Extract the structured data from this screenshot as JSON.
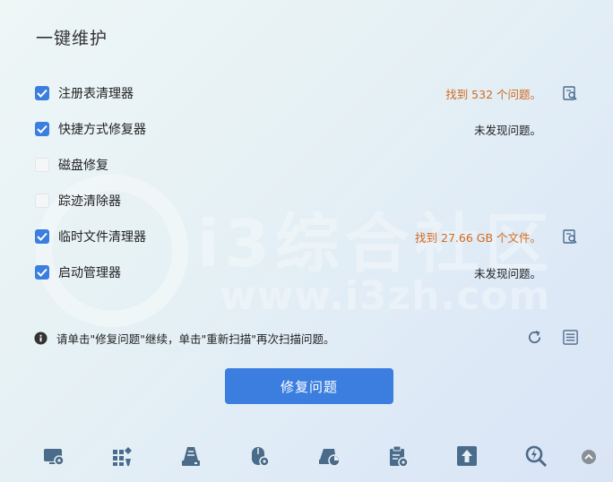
{
  "title": "一键维护",
  "items": [
    {
      "label": "注册表清理器",
      "checked": true,
      "status": "找到 532 个问题。",
      "status_type": "warn",
      "has_detail": true
    },
    {
      "label": "快捷方式修复器",
      "checked": true,
      "status": "未发现问题。",
      "status_type": "ok",
      "has_detail": false
    },
    {
      "label": "磁盘修复",
      "checked": false,
      "status": "",
      "status_type": "none",
      "has_detail": false
    },
    {
      "label": "踪迹清除器",
      "checked": false,
      "status": "",
      "status_type": "none",
      "has_detail": false
    },
    {
      "label": "临时文件清理器",
      "checked": true,
      "status": "找到 27.66 GB 个文件。",
      "status_type": "warn",
      "has_detail": true
    },
    {
      "label": "启动管理器",
      "checked": true,
      "status": "未发现问题。",
      "status_type": "ok",
      "has_detail": false
    }
  ],
  "info_text": "请单击\"修复问题\"继续，单击\"重新扫描\"再次扫描问题。",
  "fix_button": "修复问题",
  "watermark": {
    "cn": "i3综合社区",
    "en": "www.i3zh.com"
  },
  "colors": {
    "accent": "#3b7ee0",
    "warn": "#d2691e",
    "icon": "#4a6b8a"
  },
  "toolbar_icons": [
    "system-info-icon",
    "apps-icon",
    "disk-cleanup-icon",
    "mouse-settings-icon",
    "disk-usage-icon",
    "clipboard-settings-icon",
    "upload-icon",
    "search-scan-icon"
  ]
}
